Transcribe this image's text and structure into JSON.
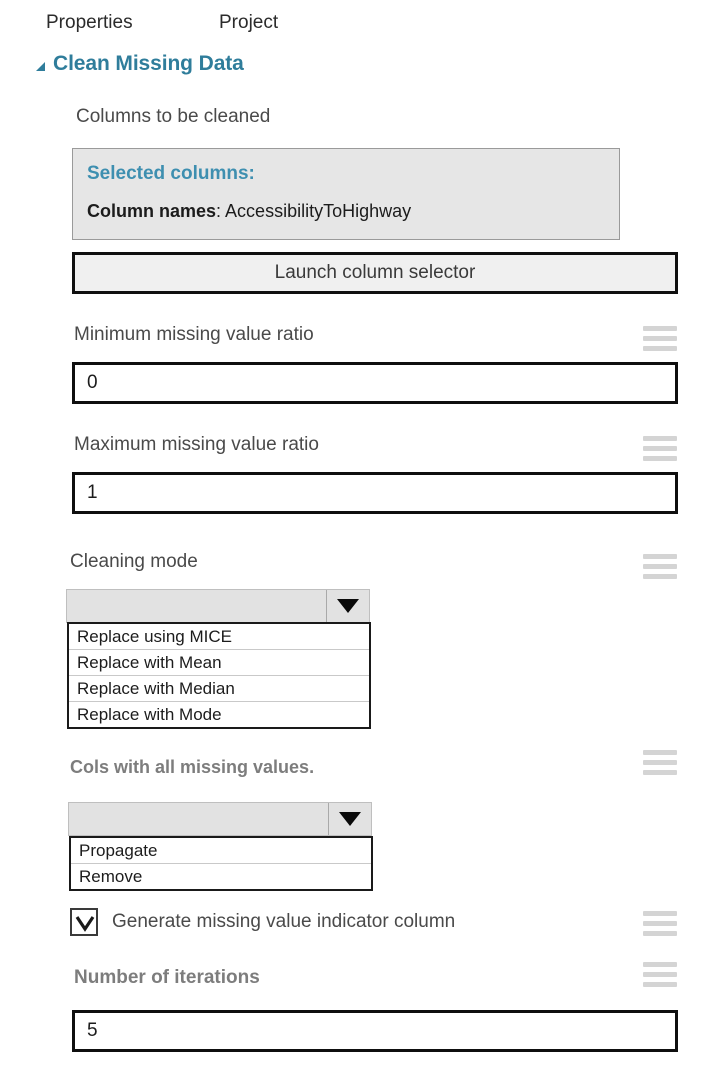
{
  "tabs": [
    {
      "label": "Properties"
    },
    {
      "label": "Project"
    }
  ],
  "module": {
    "title": "Clean Missing Data",
    "collapse_icon": "triangle-collapse-icon",
    "accent_color": "#2f7d9b"
  },
  "columns_section": {
    "label": "Columns to be cleaned",
    "selected_panel": {
      "title": "Selected columns:",
      "row_label": "Column names",
      "row_separator": ": ",
      "row_value": "AccessibilityToHighway"
    },
    "launch_button": "Launch column selector"
  },
  "min_ratio": {
    "label": "Minimum missing value ratio",
    "value": "0"
  },
  "max_ratio": {
    "label": "Maximum missing value ratio",
    "value": "1"
  },
  "cleaning_mode": {
    "label": "Cleaning mode",
    "selected": "",
    "options": [
      "Replace using MICE",
      "Replace with Mean",
      "Replace with Median",
      "Replace with Mode"
    ]
  },
  "all_missing_cols": {
    "label": "Cols with all missing values.",
    "selected": "",
    "options": [
      "Propagate",
      "Remove"
    ]
  },
  "indicator_column": {
    "label": "Generate missing value indicator column",
    "checked": true
  },
  "iterations": {
    "label": "Number of iterations",
    "value": "5"
  },
  "icons": {
    "hamburger": "hamburger-icon",
    "dropdown_arrow": "chevron-down-icon",
    "check": "check-icon"
  }
}
